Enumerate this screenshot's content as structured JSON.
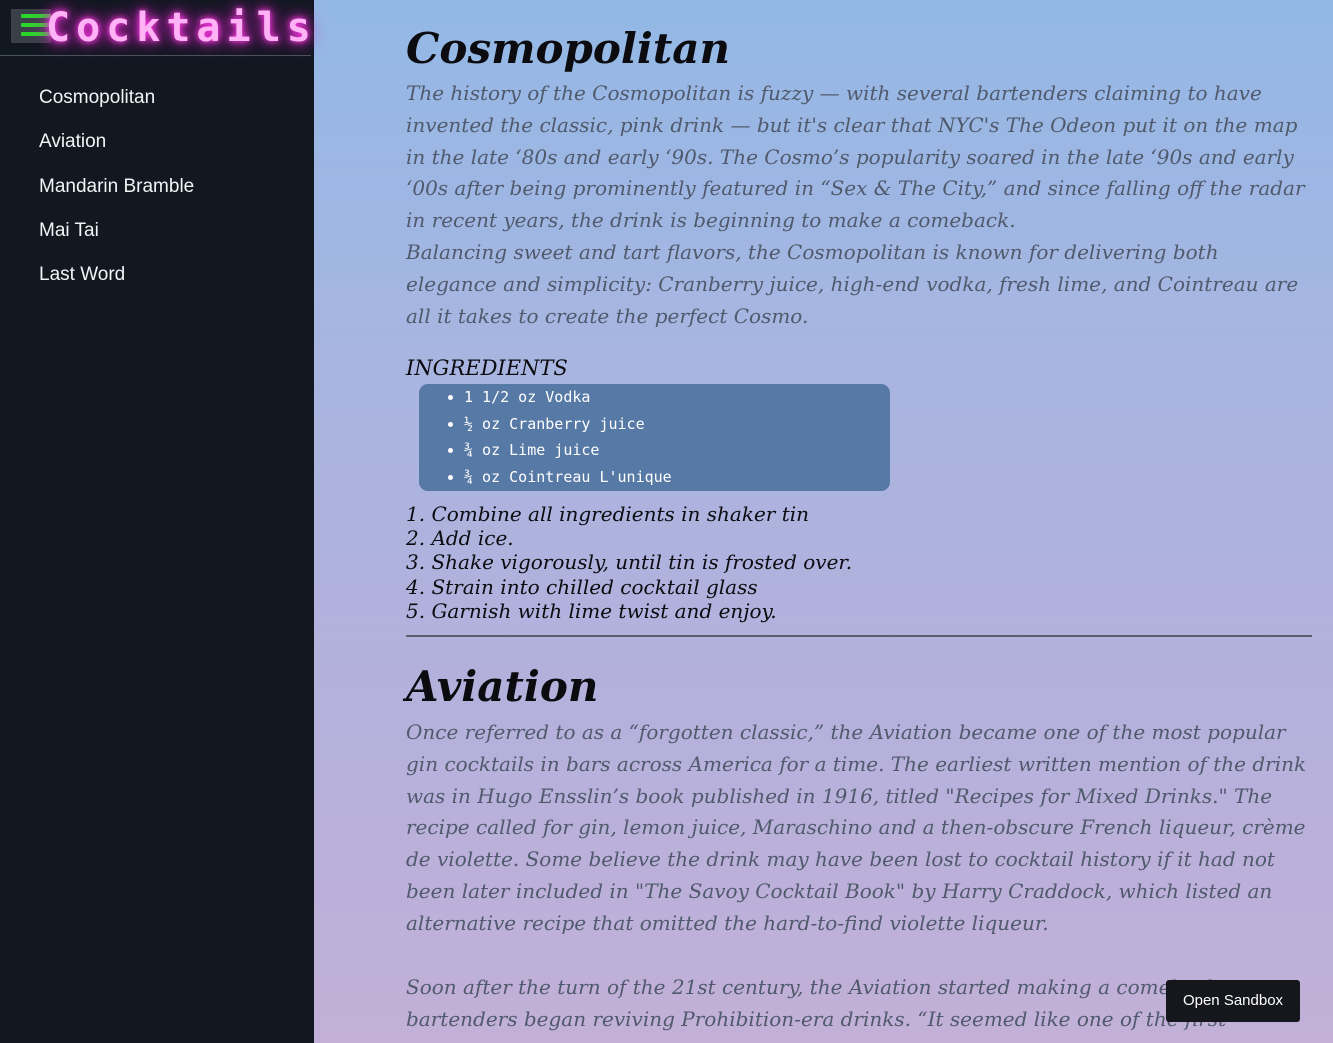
{
  "sidebar": {
    "title": "Cocktails",
    "menu_icon": "hamburger-icon",
    "items": [
      {
        "label": "Cosmopolitan"
      },
      {
        "label": "Aviation"
      },
      {
        "label": "Mandarin Bramble"
      },
      {
        "label": "Mai Tai"
      },
      {
        "label": "Last Word"
      }
    ]
  },
  "cosmopolitan": {
    "title": "Cosmopolitan",
    "description": "The history of the Cosmopolitan is fuzzy — with several bartenders claiming to have invented the classic, pink drink — but it's clear that NYC's The Odeon put it on the map in the late ‘80s and early ‘90s. The Cosmo’s popularity soared in the late ‘90s and early ‘00s after being prominently featured in “Sex & The City,” and since falling off the radar in recent years, the drink is beginning to make a comeback.",
    "description2": "Balancing sweet and tart flavors, the Cosmopolitan is known for delivering both elegance and simplicity: Cranberry juice, high-end vodka, fresh lime, and Cointreau are all it takes to create the perfect Cosmo.",
    "ingredients_label": "INGREDIENTS",
    "ingredients": [
      "1 1/2 oz Vodka",
      "½ oz Cranberry juice",
      "¾ oz Lime juice",
      "¾ oz Cointreau L'unique"
    ],
    "steps": [
      "1. Combine all ingredients in shaker tin",
      "2. Add ice.",
      "3. Shake vigorously, until tin is frosted over.",
      "4. Strain into chilled cocktail glass",
      "5. Garnish with lime twist and enjoy."
    ]
  },
  "aviation": {
    "title": "Aviation",
    "description": "Once referred to as a “forgotten classic,” the Aviation became one of the most popular gin cocktails in bars across America for a time. The earliest written mention of the drink was in Hugo Ensslin’s book published in 1916, titled \"Recipes for Mixed Drinks.\" The recipe called for gin, lemon juice, Maraschino and a then-obscure French liqueur, crème de violette. Some believe the drink may have been lost to cocktail history if it had not been later included in \"The Savoy Cocktail Book\" by Harry Craddock, which listed an alternative recipe that omitted the hard-to-find violette liqueur.",
    "description2": "Soon after the turn of the 21st century, the Aviation started making a comeback as bartenders began reviving Prohibition-era drinks. “It seemed like one of the first"
  },
  "sandbox_button": "Open Sandbox",
  "colors": {
    "sidebar_bg": "#111820",
    "neon_pink": "#ff3ee6",
    "menu_green": "#2bd72b",
    "ingredient_box": "#5779a5"
  }
}
